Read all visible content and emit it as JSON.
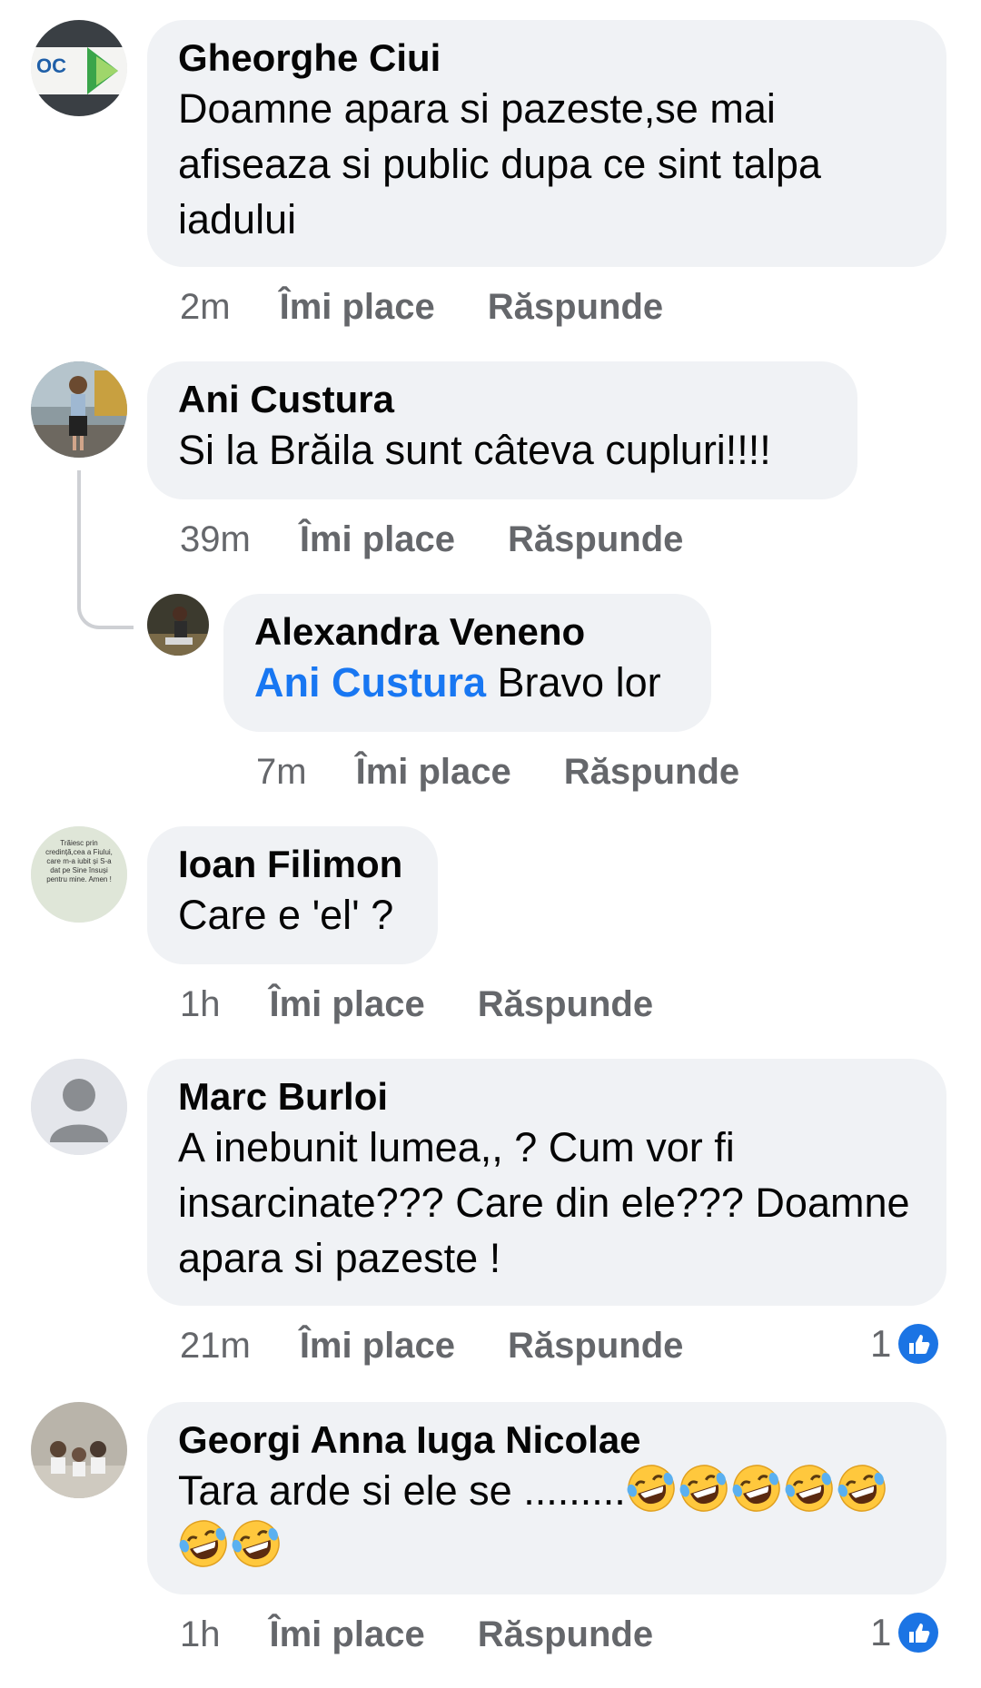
{
  "comments": [
    {
      "author": "Gheorghe Ciui",
      "text": "Doamne apara si pazeste,se mai afiseaza si public dupa ce sint talpa iadului",
      "time": "2m",
      "like": "Îmi place",
      "reply": "Răspunde",
      "avatar_text": "OC"
    },
    {
      "author": "Ani Custura",
      "text": "Si la Brăila sunt câteva cupluri!!!!",
      "time": "39m",
      "like": "Îmi place",
      "reply": "Răspunde"
    },
    {
      "author": "Alexandra Veneno",
      "mention": "Ani Custura",
      "text": " Bravo lor",
      "time": "7m",
      "like": "Îmi place",
      "reply": "Răspunde"
    },
    {
      "author": "Ioan Filimon",
      "text": "Care e 'el' ?",
      "time": "1h",
      "like": "Îmi place",
      "reply": "Răspunde",
      "avatar_text": "Trăiesc prin credință,cea a Fiului, care m-a iubit și S-a dat pe Sine însuși pentru mine. Amen !"
    },
    {
      "author": "Marc Burloi",
      "text": "A inebunit lumea,, ? Cum vor fi insarcinate??? Care din ele??? Doamne apara si pazeste !",
      "time": "21m",
      "like": "Îmi place",
      "reply": "Răspunde",
      "reaction_count": "1",
      "reaction_icon": "like-icon"
    },
    {
      "author": "Georgi Anna Iuga Nicolae",
      "text": "Tara arde si ele se .........",
      "emoji": "rolling-on-floor-laughing-emoji",
      "emoji_count": 7,
      "time": "1h",
      "like": "Îmi place",
      "reply": "Răspunde",
      "reaction_count": "1",
      "reaction_icon": "like-icon"
    }
  ],
  "colors": {
    "bubble": "#f0f2f5",
    "meta": "#65676b",
    "mention": "#1877f2",
    "like_blue": "#1b74e4"
  }
}
